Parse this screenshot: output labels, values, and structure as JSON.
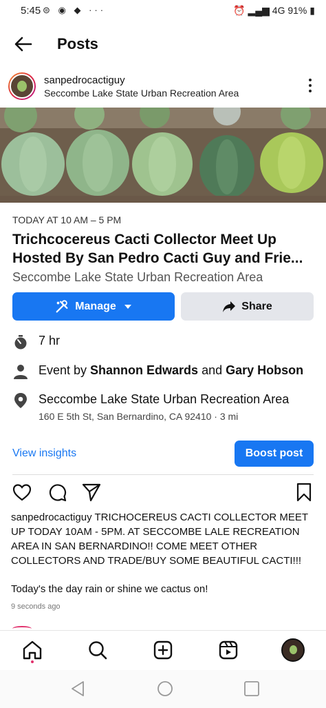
{
  "status_bar": {
    "time": "5:45",
    "battery": "91%",
    "network": "4G"
  },
  "header": {
    "title": "Posts"
  },
  "post": {
    "username": "sanpedrocactiguy",
    "location": "Seccombe Lake State Urban Recreation Area"
  },
  "event": {
    "when": "TODAY AT 10 AM – 5 PM",
    "title_line1": "Trichcocereus Cacti Collector Meet Up",
    "title_line2": "Hosted By San Pedro Cacti Guy and Frie...",
    "place": "Seccombe Lake State Urban Recreation Area",
    "manage_label": "Manage",
    "share_label": "Share",
    "duration": "7 hr",
    "hosts_prefix": "Event by ",
    "host1": "Shannon Edwards",
    "hosts_and": " and ",
    "host2": "Gary Hobson",
    "venue": "Seccombe Lake State Urban Recreation Area",
    "address": "160 E 5th St, San Bernardino, CA 92410 · 3 mi"
  },
  "insights": {
    "link_label": "View insights",
    "boost_label": "Boost post"
  },
  "caption": {
    "username": "sanpedrocactiguy",
    "text": " TRICHOCEREUS CACTI COLLECTOR MEET UP TODAY 10AM - 5PM. AT SECCOMBE LALE RECREATION AREA IN SAN BERNARDINO!! COME MEET OTHER COLLECTORS AND TRADE/BUY SOME BEAUTIFUL CACTI!!!",
    "text2": "Today's the day rain or shine we cactus on!",
    "time_ago": "9 seconds ago"
  },
  "colors": {
    "accent": "#1877f2",
    "share_bg": "#e4e6eb",
    "notification": "#e1306c"
  },
  "icons": [
    "back-arrow-icon",
    "more-icon",
    "tools-icon",
    "chevron-down-icon",
    "share-arrow-icon",
    "stopwatch-icon",
    "person-icon",
    "location-pin-icon",
    "heart-icon",
    "comment-icon",
    "send-icon",
    "bookmark-icon",
    "home-icon",
    "search-icon",
    "create-icon",
    "reels-icon",
    "profile-avatar"
  ]
}
